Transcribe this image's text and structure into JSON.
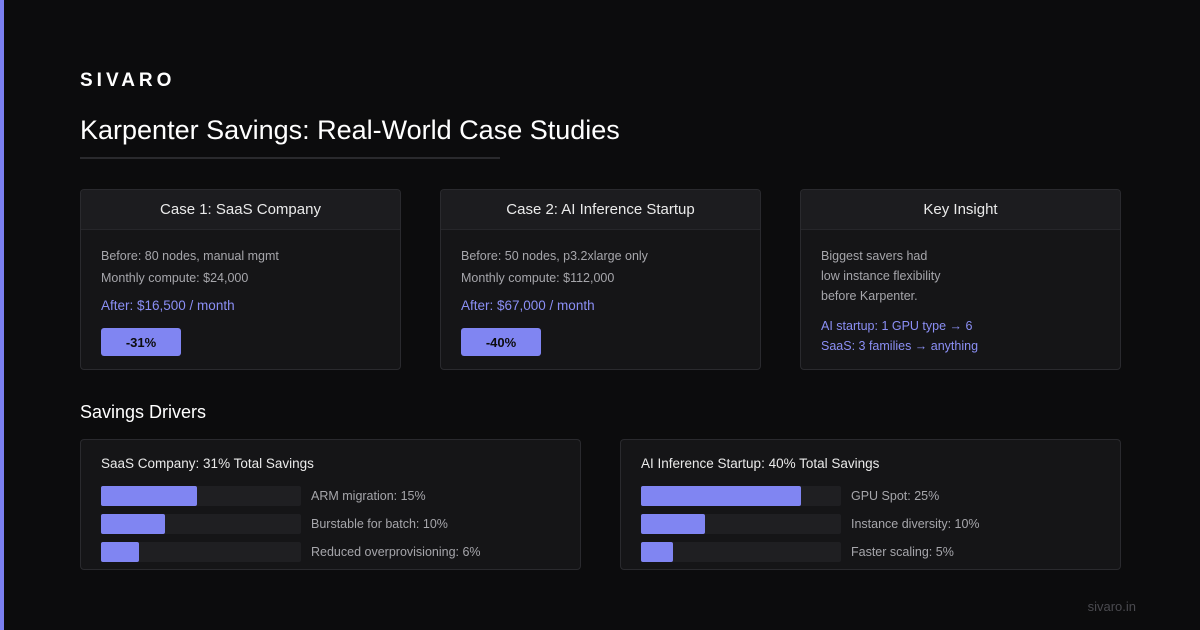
{
  "brand": "SIVARO",
  "title": "Karpenter Savings: Real-World Case Studies",
  "cases": [
    {
      "heading": "Case 1: SaaS Company",
      "before": "Before: 80 nodes, manual mgmt",
      "monthly": "Monthly compute: $24,000",
      "after": "After: $16,500 / month",
      "badge": "-31%"
    },
    {
      "heading": "Case 2: AI Inference Startup",
      "before": "Before: 50 nodes, p3.2xlarge only",
      "monthly": "Monthly compute: $112,000",
      "after": "After: $67,000 / month",
      "badge": "-40%"
    }
  ],
  "insight": {
    "heading": "Key Insight",
    "line1": "Biggest savers had",
    "line2": "low instance flexibility",
    "line3": "before Karpenter.",
    "ai": "AI startup: 1 GPU type → 6",
    "saas": "SaaS: 3 families → anything"
  },
  "drivers_title": "Savings Drivers",
  "panels": [
    {
      "title": "SaaS Company: 31% Total Savings",
      "drivers": [
        {
          "label": "ARM migration: 15%",
          "pct": 15
        },
        {
          "label": "Burstable for batch: 10%",
          "pct": 10
        },
        {
          "label": "Reduced overprovisioning: 6%",
          "pct": 6
        }
      ]
    },
    {
      "title": "AI Inference Startup: 40% Total Savings",
      "drivers": [
        {
          "label": "GPU Spot: 25%",
          "pct": 25
        },
        {
          "label": "Instance diversity: 10%",
          "pct": 10
        },
        {
          "label": "Faster scaling: 5%",
          "pct": 5
        }
      ]
    }
  ],
  "footer": "sivaro.in",
  "colors": {
    "accent": "#8085f2",
    "background": "#0c0c0d",
    "card": "#151517"
  }
}
